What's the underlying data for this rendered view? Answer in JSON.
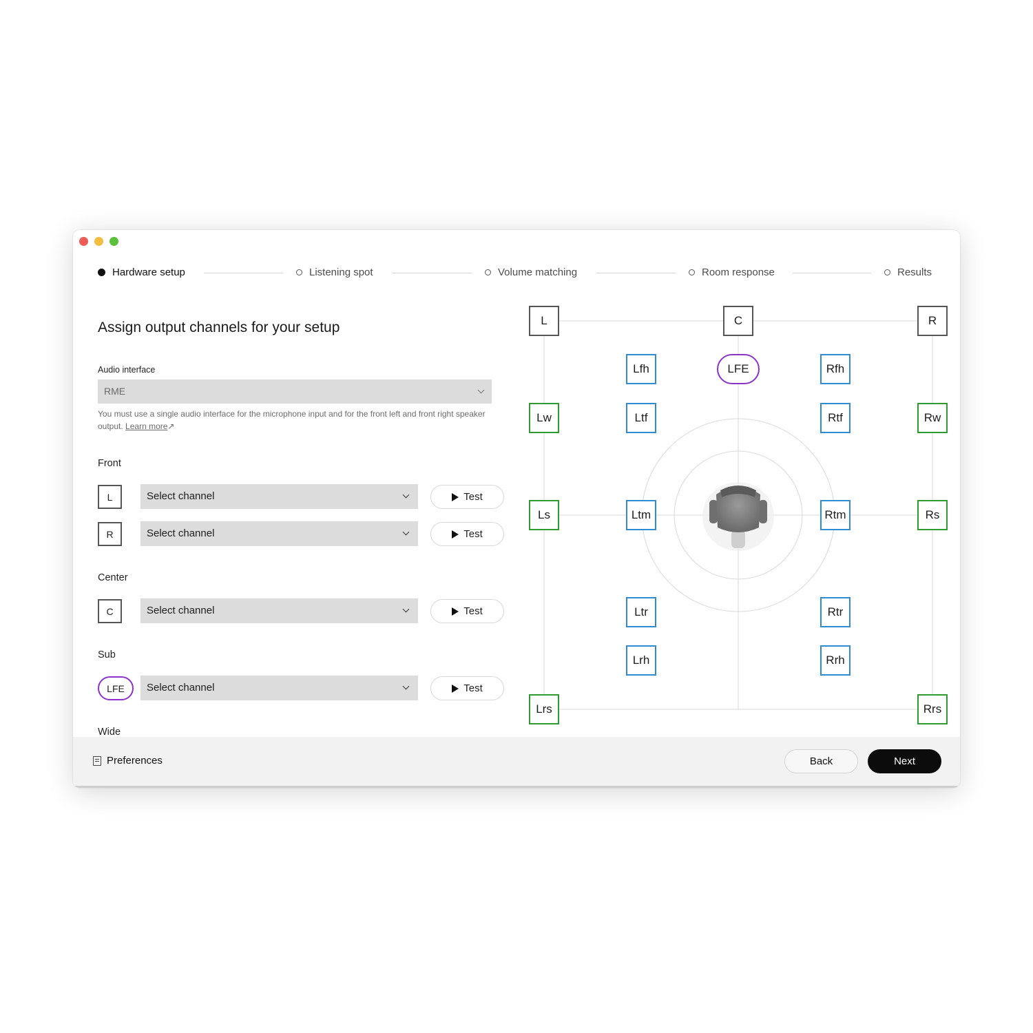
{
  "steps": [
    "Hardware setup",
    "Listening spot",
    "Volume matching",
    "Room response",
    "Results"
  ],
  "active_step": "Hardware setup",
  "page_title": "Assign output channels for your setup",
  "audio_interface": {
    "label": "Audio interface",
    "value": "RME",
    "helper": "You must use a single audio interface for the microphone input and for the front left and front right speaker output.",
    "link": "Learn more"
  },
  "groups": {
    "front": "Front",
    "center": "Center",
    "sub": "Sub",
    "wide": "Wide"
  },
  "channels": {
    "L": {
      "badge": "L",
      "select": "Select channel",
      "test": "Test"
    },
    "R": {
      "badge": "R",
      "select": "Select channel",
      "test": "Test"
    },
    "C": {
      "badge": "C",
      "select": "Select channel",
      "test": "Test"
    },
    "LFE": {
      "badge": "LFE",
      "select": "Select channel",
      "test": "Test"
    }
  },
  "speakers": {
    "L": "L",
    "C": "C",
    "R": "R",
    "Lfh": "Lfh",
    "LFE": "LFE",
    "Rfh": "Rfh",
    "Lw": "Lw",
    "Ltf": "Ltf",
    "Rtf": "Rtf",
    "Rw": "Rw",
    "Ls": "Ls",
    "Ltm": "Ltm",
    "Rtm": "Rtm",
    "Rs": "Rs",
    "Ltr": "Ltr",
    "Rtr": "Rtr",
    "Lrh": "Lrh",
    "Rrh": "Rrh",
    "Lrs": "Lrs",
    "Rrs": "Rrs"
  },
  "speaker_colors": {
    "main": "#555555",
    "wide_surround": "#2f9a2f",
    "height": "#2f8cd2",
    "sub": "#8a33c9"
  },
  "footer": {
    "preferences": "Preferences",
    "back": "Back",
    "next": "Next"
  }
}
